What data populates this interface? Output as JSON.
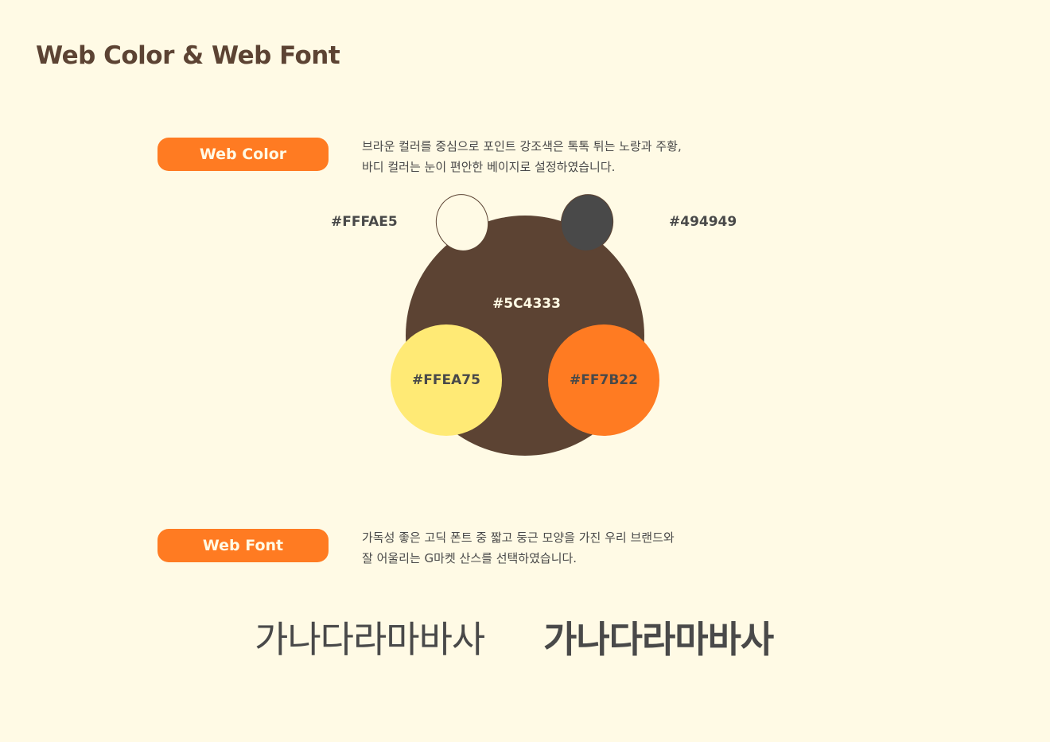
{
  "title": "Web Color & Web Font",
  "web_color": {
    "badge": "Web Color",
    "description": [
      "브라운 컬러를 중심으로 포인트 강조색은 톡톡 튀는 노랑과 주황,",
      "바디 컬러는 눈이 편안한 베이지로 설정하였습니다."
    ],
    "swatches": {
      "beige": "#FFFAE5",
      "gray": "#494949",
      "brown": "#5C4333",
      "yellow": "#FFEA75",
      "orange": "#FF7B22"
    }
  },
  "web_font": {
    "badge": "Web Font",
    "description": [
      "가독성 좋은 고딕 폰트 중 짧고 둥근 모양을 가진 우리 브랜드와",
      "잘 어울리는 G마켓 산스를 선택하였습니다."
    ],
    "sample_regular": "가나다라마바사",
    "sample_bold": "가나다라마바사"
  }
}
